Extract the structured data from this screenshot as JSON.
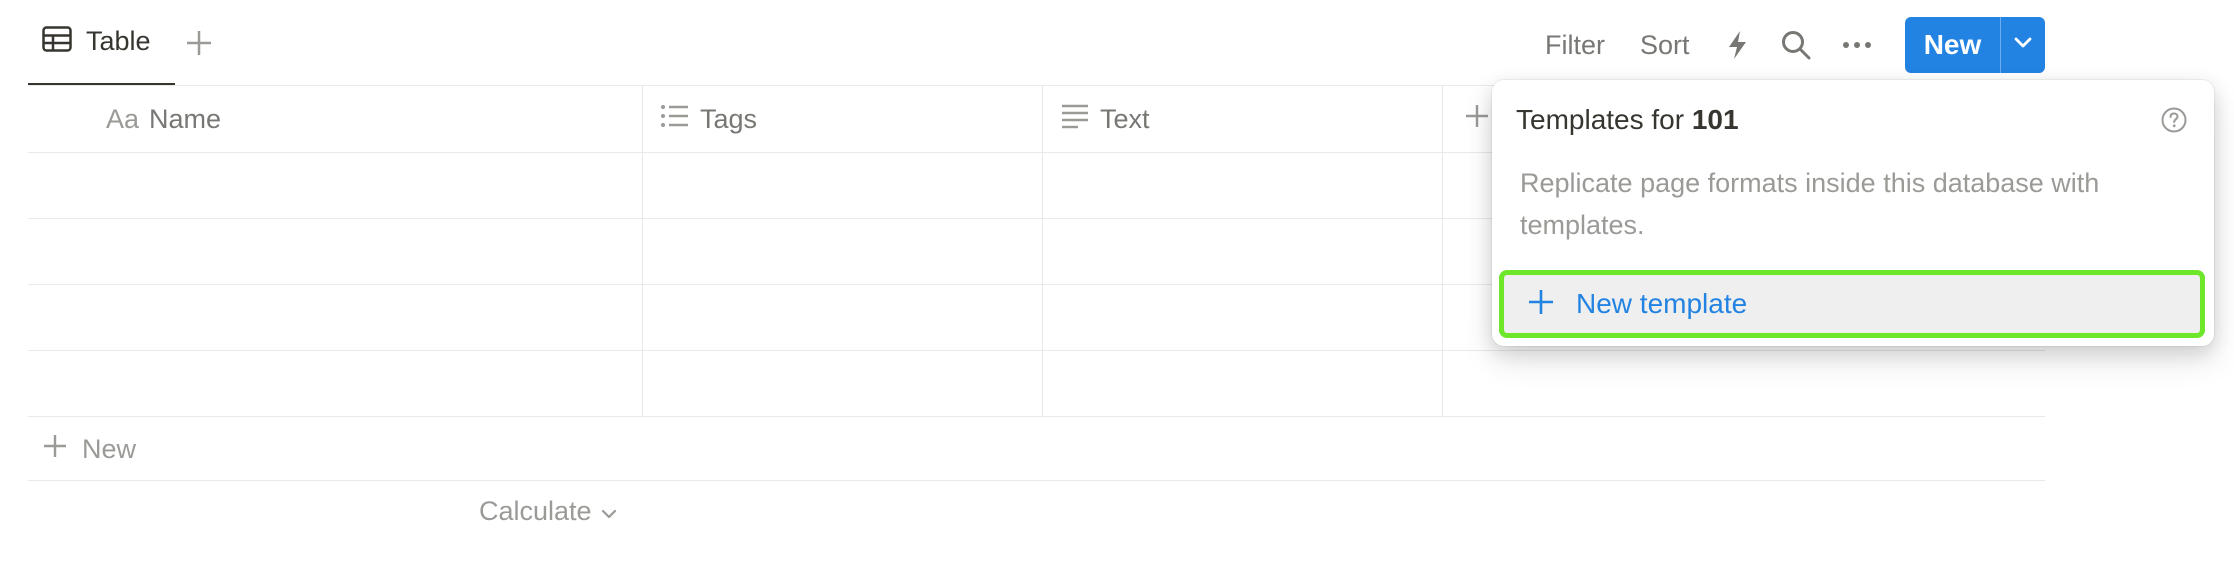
{
  "view_tabs": {
    "active_label": "Table",
    "active_icon": "table-icon",
    "add_icon": "plus-icon"
  },
  "toolbar": {
    "filter_label": "Filter",
    "sort_label": "Sort",
    "automation_icon": "lightning-icon",
    "search_icon": "search-icon",
    "more_icon": "more-icon",
    "new_label": "New",
    "new_dropdown_icon": "chevron-down-icon",
    "accent_color": "#2383e2"
  },
  "table": {
    "columns": [
      {
        "label": "Name",
        "icon": "text-type-icon",
        "icon_text": "Aa"
      },
      {
        "label": "Tags",
        "icon": "list-icon"
      },
      {
        "label": "Text",
        "icon": "text-lines-icon"
      }
    ],
    "add_column_icon": "plus-icon",
    "empty_rows": 4,
    "add_row_label": "New",
    "calculate_label": "Calculate"
  },
  "templates_popup": {
    "title_prefix": "Templates for ",
    "database_name": "101",
    "help_icon": "help-icon",
    "description": "Replicate page formats inside this database with templates.",
    "new_template_label": "New template",
    "highlight_color": "#6ee62a"
  }
}
